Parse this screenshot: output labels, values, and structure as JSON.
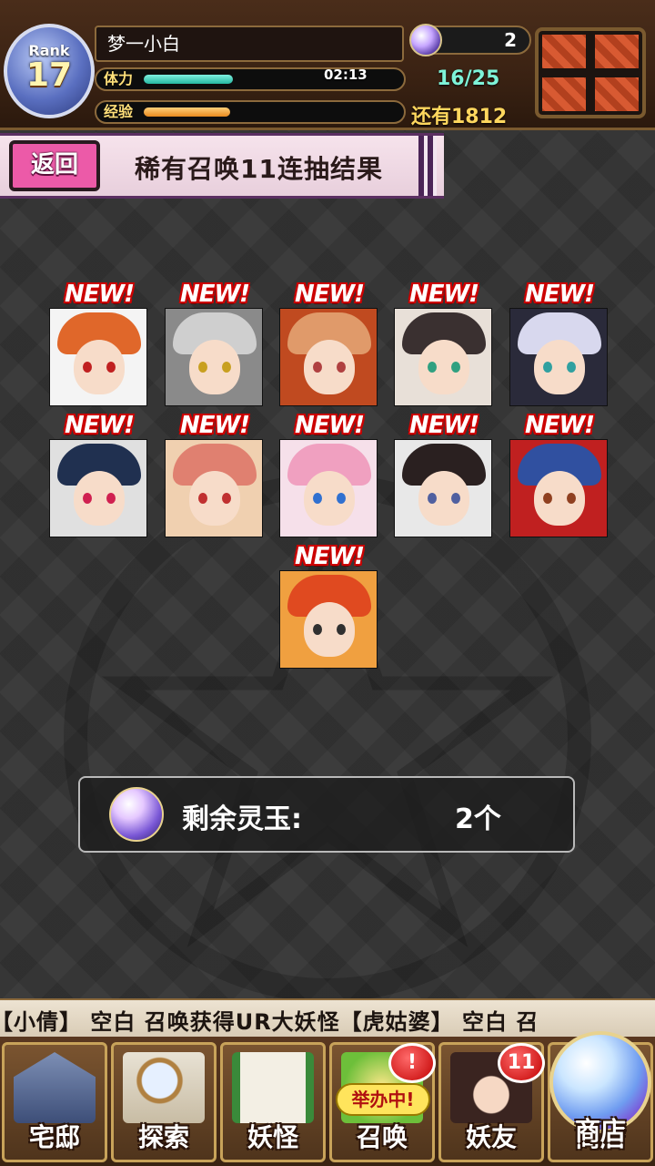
{
  "header": {
    "rank_label": "Rank",
    "rank_value": "17",
    "player_name": "梦一小白",
    "stamina_label": "体力",
    "stamina_timer": "02:13",
    "stamina_fill_fraction": 0.36,
    "stamina_text": "16/25",
    "exp_label": "经验",
    "exp_fill_fraction": 0.35,
    "exp_text": "还有1812",
    "orb_count": "2",
    "gift_icon": "gift-box-icon"
  },
  "title_bar": {
    "back_label": "返回",
    "title": "稀有召唤11连抽结果"
  },
  "results": {
    "new_label": "NEW!",
    "cards": [
      {
        "hair": "#e0672a",
        "eye": "#c02020",
        "bg": "#f4f4f4"
      },
      {
        "hair": "#cfcfcf",
        "eye": "#c8a020",
        "bg": "#8a8a8a"
      },
      {
        "hair": "#e09a6a",
        "eye": "#b04040",
        "bg": "#c04a20"
      },
      {
        "hair": "#3a3030",
        "eye": "#30a080",
        "bg": "#e8e0d8"
      },
      {
        "hair": "#d8d8ee",
        "eye": "#30a0a0",
        "bg": "#2a2a3a"
      },
      {
        "hair": "#203050",
        "eye": "#d02050",
        "bg": "#e0e0e0"
      },
      {
        "hair": "#e08070",
        "eye": "#c03030",
        "bg": "#f0d0b0"
      },
      {
        "hair": "#f0a0c0",
        "eye": "#3070d0",
        "bg": "#f6e0ea"
      },
      {
        "hair": "#2a2020",
        "eye": "#5060a0",
        "bg": "#e8e8e8"
      },
      {
        "hair": "#3050a0",
        "eye": "#904020",
        "bg": "#c02020"
      },
      {
        "hair": "#e04a20",
        "eye": "#303030",
        "bg": "#f0a040"
      }
    ]
  },
  "remaining": {
    "label": "剩余灵玉:",
    "count": "2个"
  },
  "ticker": {
    "text": "【小倩】    空白 召唤获得UR大妖怪【虎姑婆】    空白 召"
  },
  "nav": {
    "items": [
      {
        "label": "宅邸",
        "icon": "mansion-icon"
      },
      {
        "label": "探索",
        "icon": "magnifier-map-icon"
      },
      {
        "label": "妖怪",
        "icon": "scroll-icon"
      },
      {
        "label": "召唤",
        "icon": "summon-icon",
        "badge": "!",
        "tag": "举办中!"
      },
      {
        "label": "妖友",
        "icon": "friend-girl-icon",
        "badge": "11"
      },
      {
        "label": "商店",
        "icon": "shop-orb-icon"
      }
    ]
  },
  "colors": {
    "accent_pink": "#ec5aa8",
    "badge_red": "#c10000",
    "stamina_teal": "#3fd6c0",
    "exp_orange": "#f3a12e"
  }
}
